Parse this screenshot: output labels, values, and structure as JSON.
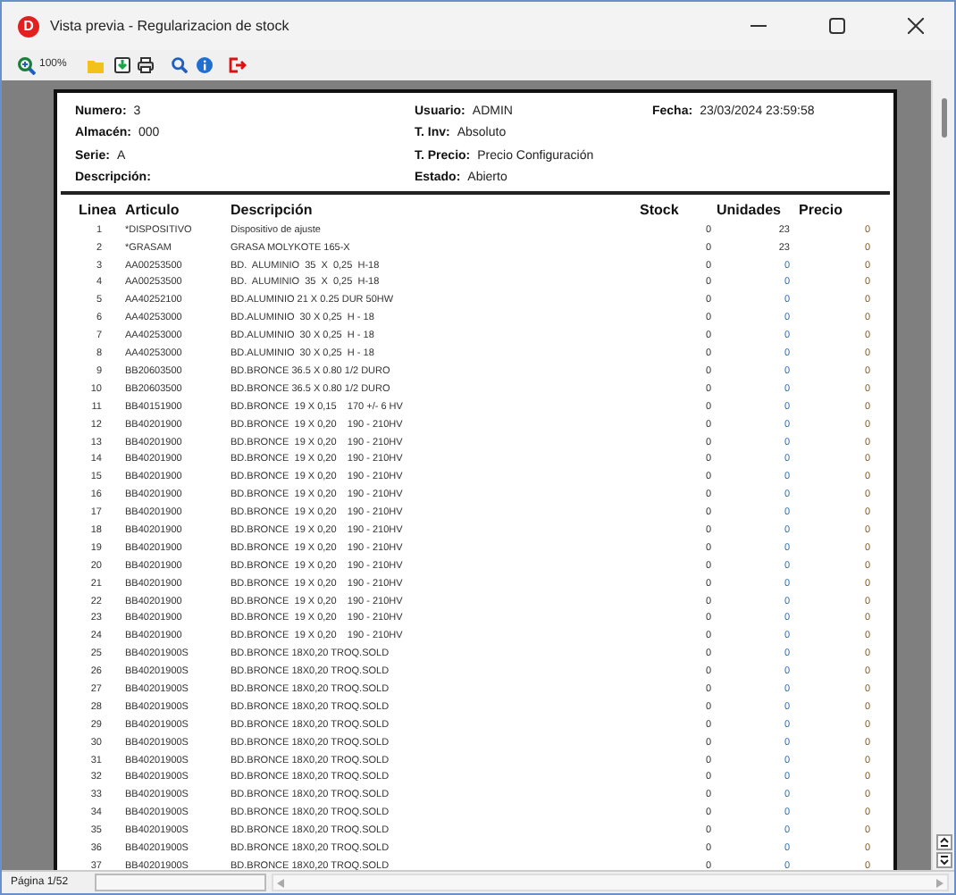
{
  "window": {
    "title": "Vista previa - Regularizacion de stock",
    "logo_letter": "D"
  },
  "toolbar": {
    "zoom": "100%"
  },
  "header": {
    "columns": [
      [
        {
          "label": "Numero:",
          "value": "3"
        },
        {
          "label": "Almacén:",
          "value": "000"
        },
        {
          "label": "Serie:",
          "value": "A"
        },
        {
          "label": "Descripción:"
        }
      ],
      [
        {
          "label": "Usuario:",
          "value": "ADMIN"
        },
        {
          "label": "T. Inv:",
          "value": "Absoluto"
        },
        {
          "label": "T. Precio:",
          "value": "Precio Configuración"
        },
        {
          "label": "Estado:",
          "value": "Abierto"
        }
      ],
      [
        {
          "label": "Fecha:",
          "value": "23/03/2024 23:59:58"
        }
      ]
    ]
  },
  "table": {
    "columns": [
      "Linea",
      "Articulo",
      "Descripción",
      "Stock",
      "Unidades",
      "Precio"
    ],
    "rows": [
      [
        "1",
        "*DISPOSITIVO",
        "Dispositivo de ajuste",
        "0",
        "23",
        "0"
      ],
      [
        "2",
        "*GRASAM",
        "GRASA MOLYKOTE 165-X",
        "0",
        "23",
        "0"
      ],
      [
        "3",
        "AA00253500",
        "BD.  ALUMINIO  35  X  0,25  H-18",
        "0",
        "0",
        "0"
      ],
      [
        "4",
        "AA00253500",
        "BD.  ALUMINIO  35  X  0,25  H-18",
        "0",
        "0",
        "0"
      ],
      [
        "5",
        "AA40252100",
        "BD.ALUMINIO 21 X 0.25 DUR 50HW",
        "0",
        "0",
        "0"
      ],
      [
        "6",
        "AA40253000",
        "BD.ALUMINIO  30 X 0,25  H - 18",
        "0",
        "0",
        "0"
      ],
      [
        "7",
        "AA40253000",
        "BD.ALUMINIO  30 X 0,25  H - 18",
        "0",
        "0",
        "0"
      ],
      [
        "8",
        "AA40253000",
        "BD.ALUMINIO  30 X 0,25  H - 18",
        "0",
        "0",
        "0"
      ],
      [
        "9",
        "BB20603500",
        "BD.BRONCE 36.5 X 0.80 1/2 DURO",
        "0",
        "0",
        "0"
      ],
      [
        "10",
        "BB20603500",
        "BD.BRONCE 36.5 X 0.80 1/2 DURO",
        "0",
        "0",
        "0"
      ],
      [
        "11",
        "BB40151900",
        "BD.BRONCE  19 X 0,15    170 +/- 6 HV",
        "0",
        "0",
        "0"
      ],
      [
        "12",
        "BB40201900",
        "BD.BRONCE  19 X 0,20    190 - 210HV",
        "0",
        "0",
        "0"
      ],
      [
        "13",
        "BB40201900",
        "BD.BRONCE  19 X 0,20    190 - 210HV",
        "0",
        "0",
        "0"
      ],
      [
        "14",
        "BB40201900",
        "BD.BRONCE  19 X 0,20    190 - 210HV",
        "0",
        "0",
        "0"
      ],
      [
        "15",
        "BB40201900",
        "BD.BRONCE  19 X 0,20    190 - 210HV",
        "0",
        "0",
        "0"
      ],
      [
        "16",
        "BB40201900",
        "BD.BRONCE  19 X 0,20    190 - 210HV",
        "0",
        "0",
        "0"
      ],
      [
        "17",
        "BB40201900",
        "BD.BRONCE  19 X 0,20    190 - 210HV",
        "0",
        "0",
        "0"
      ],
      [
        "18",
        "BB40201900",
        "BD.BRONCE  19 X 0,20    190 - 210HV",
        "0",
        "0",
        "0"
      ],
      [
        "19",
        "BB40201900",
        "BD.BRONCE  19 X 0,20    190 - 210HV",
        "0",
        "0",
        "0"
      ],
      [
        "20",
        "BB40201900",
        "BD.BRONCE  19 X 0,20    190 - 210HV",
        "0",
        "0",
        "0"
      ],
      [
        "21",
        "BB40201900",
        "BD.BRONCE  19 X 0,20    190 - 210HV",
        "0",
        "0",
        "0"
      ],
      [
        "22",
        "BB40201900",
        "BD.BRONCE  19 X 0,20    190 - 210HV",
        "0",
        "0",
        "0"
      ],
      [
        "23",
        "BB40201900",
        "BD.BRONCE  19 X 0,20    190 - 210HV",
        "0",
        "0",
        "0"
      ],
      [
        "24",
        "BB40201900",
        "BD.BRONCE  19 X 0,20    190 - 210HV",
        "0",
        "0",
        "0"
      ],
      [
        "25",
        "BB40201900S",
        "BD.BRONCE 18X0,20 TROQ.SOLD",
        "0",
        "0",
        "0"
      ],
      [
        "26",
        "BB40201900S",
        "BD.BRONCE 18X0,20 TROQ.SOLD",
        "0",
        "0",
        "0"
      ],
      [
        "27",
        "BB40201900S",
        "BD.BRONCE 18X0,20 TROQ.SOLD",
        "0",
        "0",
        "0"
      ],
      [
        "28",
        "BB40201900S",
        "BD.BRONCE 18X0,20 TROQ.SOLD",
        "0",
        "0",
        "0"
      ],
      [
        "29",
        "BB40201900S",
        "BD.BRONCE 18X0,20 TROQ.SOLD",
        "0",
        "0",
        "0"
      ],
      [
        "30",
        "BB40201900S",
        "BD.BRONCE 18X0,20 TROQ.SOLD",
        "0",
        "0",
        "0"
      ],
      [
        "31",
        "BB40201900S",
        "BD.BRONCE 18X0,20 TROQ.SOLD",
        "0",
        "0",
        "0"
      ],
      [
        "32",
        "BB40201900S",
        "BD.BRONCE 18X0,20 TROQ.SOLD",
        "0",
        "0",
        "0"
      ],
      [
        "33",
        "BB40201900S",
        "BD.BRONCE 18X0,20 TROQ.SOLD",
        "0",
        "0",
        "0"
      ],
      [
        "34",
        "BB40201900S",
        "BD.BRONCE 18X0,20 TROQ.SOLD",
        "0",
        "0",
        "0"
      ],
      [
        "35",
        "BB40201900S",
        "BD.BRONCE 18X0,20 TROQ.SOLD",
        "0",
        "0",
        "0"
      ],
      [
        "36",
        "BB40201900S",
        "BD.BRONCE 18X0,20 TROQ.SOLD",
        "0",
        "0",
        "0"
      ],
      [
        "37",
        "BB40201900S",
        "BD.BRONCE 18X0,20 TROQ.SOLD",
        "0",
        "0",
        "0"
      ]
    ]
  },
  "status_bar": {
    "page": "Página 1/52"
  }
}
